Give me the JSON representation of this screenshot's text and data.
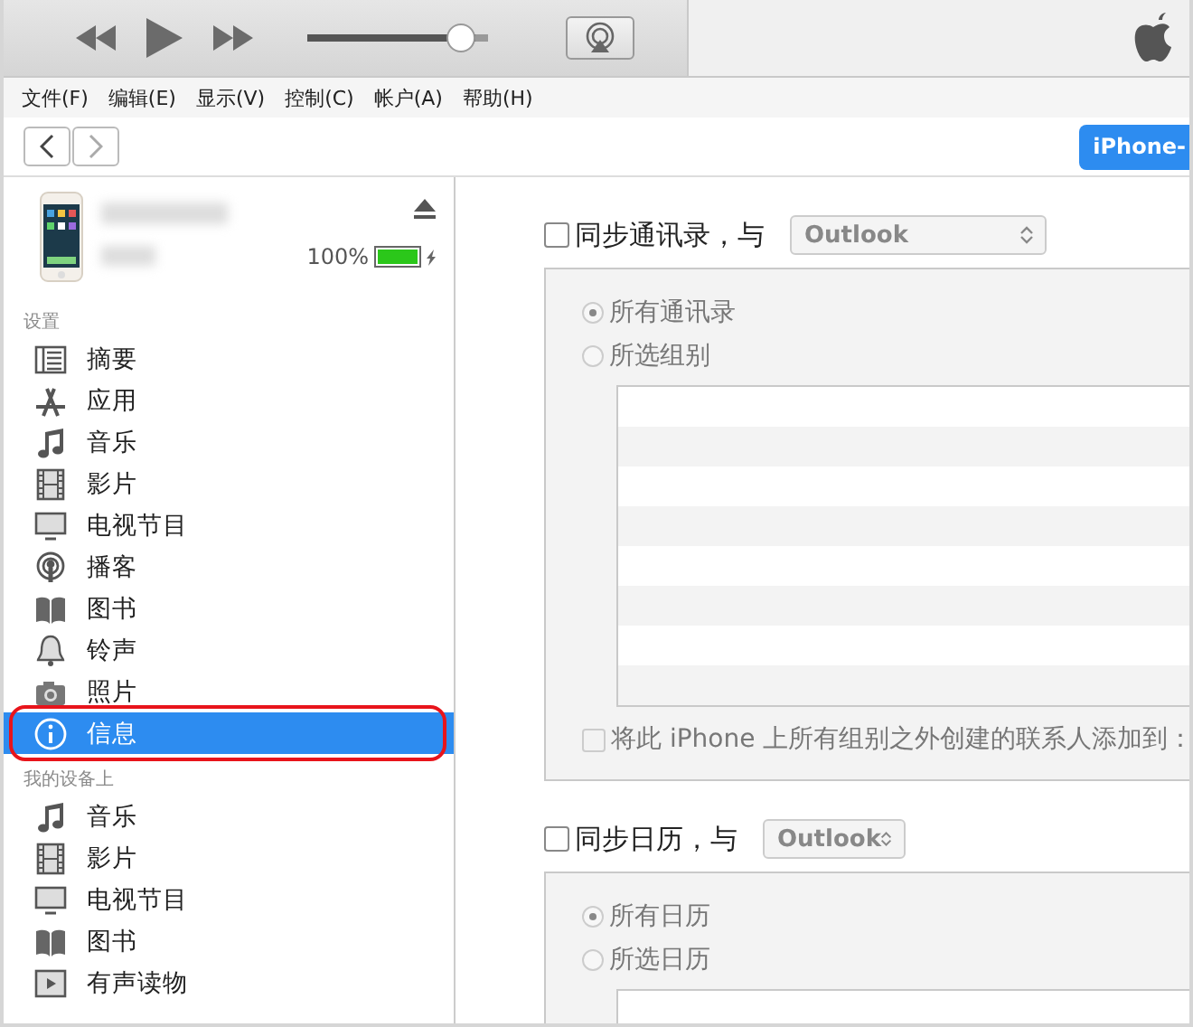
{
  "player": {
    "volume": {
      "level": 0.93
    }
  },
  "menu": [
    "文件(F)",
    "编辑(E)",
    "显示(V)",
    "控制(C)",
    "帐户(A)",
    "帮助(H)"
  ],
  "device_button": {
    "label": "iPhone-"
  },
  "device": {
    "battery": "100%",
    "battery_level": {
      "level": 1
    }
  },
  "sidebar": [
    {
      "heading": "设置",
      "items": [
        {
          "label": "摘要",
          "kind": "list",
          "selected": false
        },
        {
          "label": "应用",
          "kind": "apps",
          "selected": false
        },
        {
          "label": "音乐",
          "kind": "music",
          "selected": false
        },
        {
          "label": "影片",
          "kind": "film",
          "selected": false
        },
        {
          "label": "电视节目",
          "kind": "tv",
          "selected": false
        },
        {
          "label": "播客",
          "kind": "podcast",
          "selected": false
        },
        {
          "label": "图书",
          "kind": "book",
          "selected": false
        },
        {
          "label": "铃声",
          "kind": "bell",
          "selected": false
        },
        {
          "label": "照片",
          "kind": "camera",
          "selected": false
        },
        {
          "label": "信息",
          "kind": "info",
          "selected": true
        }
      ]
    },
    {
      "heading": "我的设备上",
      "items": [
        {
          "label": "音乐",
          "kind": "music",
          "selected": false
        },
        {
          "label": "影片",
          "kind": "film",
          "selected": false
        },
        {
          "label": "电视节目",
          "kind": "tv",
          "selected": false
        },
        {
          "label": "图书",
          "kind": "book",
          "selected": false
        },
        {
          "label": "有声读物",
          "kind": "audiobook",
          "selected": false
        }
      ]
    }
  ],
  "sections": [
    {
      "label": "同步通讯录，与",
      "checked": false,
      "source": "Outlook",
      "options": [
        {
          "label": "所有通讯录",
          "selected": true
        },
        {
          "label": "所选组别",
          "selected": false
        }
      ],
      "footer": {
        "label": "将此 iPhone 上所有组别之外创建的联系人添加到：",
        "checked": false
      }
    },
    {
      "label": "同步日历，与",
      "checked": false,
      "source": "Outlook",
      "options": [
        {
          "label": "所有日历",
          "selected": true
        },
        {
          "label": "所选日历",
          "selected": false
        }
      ]
    }
  ]
}
